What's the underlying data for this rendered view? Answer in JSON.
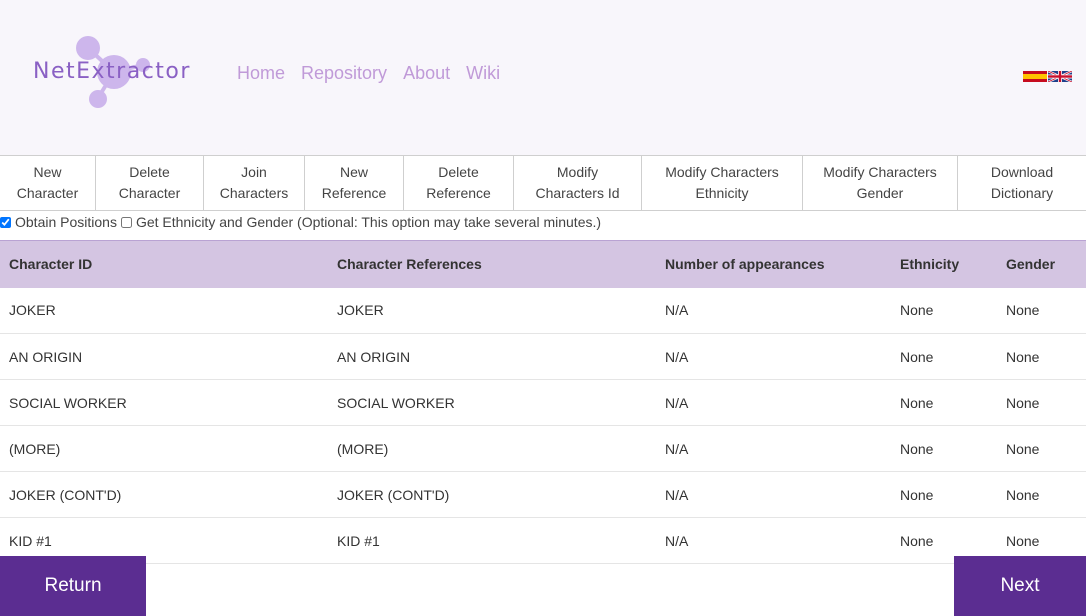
{
  "header": {
    "logo_text": "NetExtractor",
    "nav": [
      "Home",
      "Repository",
      "About",
      "Wiki"
    ],
    "flags": [
      "spanish-flag-icon",
      "uk-flag-icon"
    ]
  },
  "toolbar": {
    "buttons": [
      "New\nCharacter",
      "Delete\nCharacter",
      "Join\nCharacters",
      "New\nReference",
      "Delete\nReference",
      "Modify\nCharacters Id",
      "Modify Characters\nEthnicity",
      "Modify Characters\nGender",
      "Download\nDictionary"
    ]
  },
  "options": {
    "obtain_positions": {
      "label": "Obtain Positions",
      "checked": true
    },
    "ethnicity_gender": {
      "label": "Get Ethnicity and Gender (Optional: This option may take several minutes.)",
      "checked": false
    }
  },
  "table": {
    "columns": [
      "Character ID",
      "Character References",
      "Number of appearances",
      "Ethnicity",
      "Gender"
    ],
    "rows": [
      [
        "JOKER",
        "JOKER",
        "N/A",
        "None",
        "None"
      ],
      [
        "AN ORIGIN",
        "AN ORIGIN",
        "N/A",
        "None",
        "None"
      ],
      [
        "SOCIAL WORKER",
        "SOCIAL WORKER",
        "N/A",
        "None",
        "None"
      ],
      [
        "(MORE)",
        "(MORE)",
        "N/A",
        "None",
        "None"
      ],
      [
        "JOKER (CONT'D)",
        "JOKER (CONT'D)",
        "N/A",
        "None",
        "None"
      ],
      [
        "KID #1",
        "KID #1",
        "N/A",
        "None",
        "None"
      ]
    ]
  },
  "footer": {
    "return_label": "Return",
    "next_label": "Next"
  },
  "colors": {
    "accent": "#5b2d91",
    "nav_link": "#c09ad8",
    "table_header": "#d4c5e2",
    "header_bg": "#f8f6fb"
  }
}
